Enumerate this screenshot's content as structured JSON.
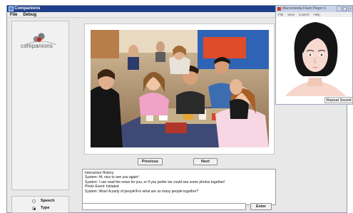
{
  "app": {
    "title": "Companions",
    "menu": [
      "File",
      "Debug"
    ]
  },
  "logo": {
    "text": "companions"
  },
  "photo": {
    "alt_description": "Group photo of friends at a restaurant table"
  },
  "nav": {
    "previous_label": "Previous",
    "next_label": "Next"
  },
  "history": {
    "lines": [
      "Interaction History",
      "System: Hi, nice to see you again!",
      "System: I can read the news for you, or if you prefer we could see some photos together!",
      "Photo Event: Initiated",
      "System: Wow! A party of people!For what are so many people together?"
    ]
  },
  "input": {
    "value": ""
  },
  "enter_label": "Enter",
  "mode": {
    "options": [
      {
        "label": "Speech",
        "selected": false
      },
      {
        "label": "Type",
        "selected": true
      }
    ]
  },
  "flash": {
    "title": "Macromedia Flash Player 6",
    "menu": [
      "File",
      "View",
      "Control",
      "Help"
    ],
    "repeat_label": "Repeat Sound"
  }
}
